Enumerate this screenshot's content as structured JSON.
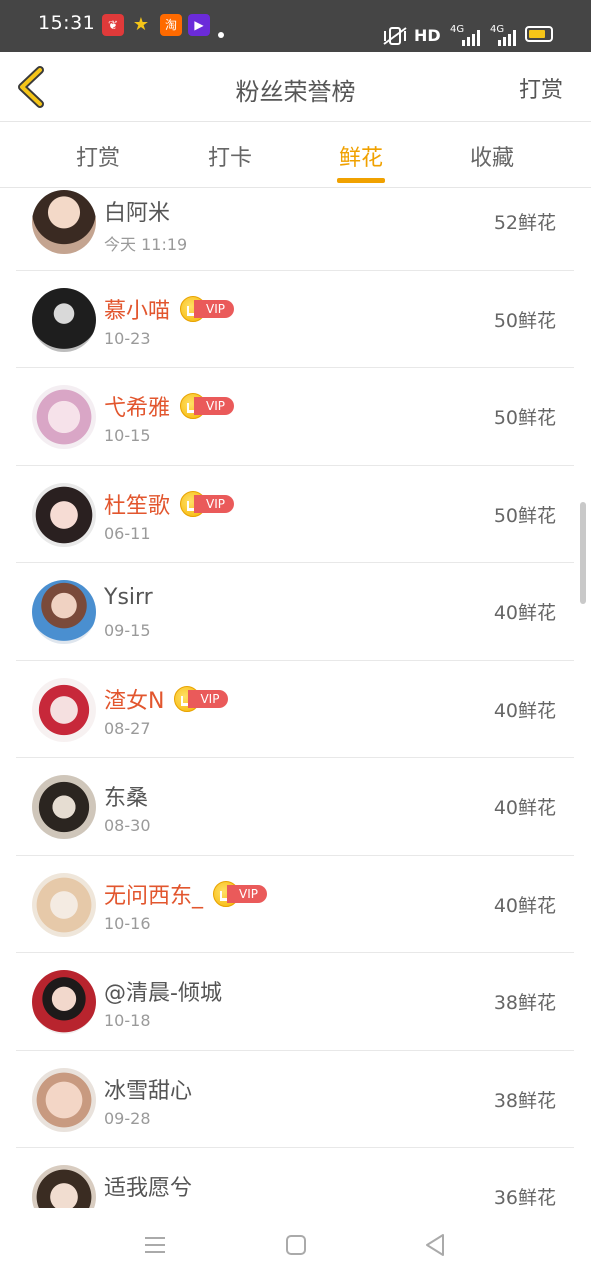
{
  "status_bar": {
    "time": "15:31",
    "network": "HD",
    "signal1": "4G",
    "signal2": "4G",
    "battery_level": 0.8
  },
  "header": {
    "title": "粉丝荣誉榜",
    "right_action": "打赏"
  },
  "tabs": [
    {
      "label": "打赏",
      "active": false
    },
    {
      "label": "打卡",
      "active": false
    },
    {
      "label": "鲜花",
      "active": true
    },
    {
      "label": "收藏",
      "active": false
    }
  ],
  "fans": [
    {
      "name": "白阿米",
      "date": "今天 11:19",
      "amount": "52鲜花",
      "vip": false
    },
    {
      "name": "慕小喵",
      "date": "10-23",
      "amount": "50鲜花",
      "vip": true,
      "vip_label": "VIP"
    },
    {
      "name": "弋希雅",
      "date": "10-15",
      "amount": "50鲜花",
      "vip": true,
      "vip_label": "VIP"
    },
    {
      "name": "杜笙歌",
      "date": "06-11",
      "amount": "50鲜花",
      "vip": true,
      "vip_label": "VIP"
    },
    {
      "name": "Ysirr",
      "date": "09-15",
      "amount": "40鲜花",
      "vip": false
    },
    {
      "name": "渣女N",
      "date": "08-27",
      "amount": "40鲜花",
      "vip": true,
      "vip_label": "VIP"
    },
    {
      "name": "东桑",
      "date": "08-30",
      "amount": "40鲜花",
      "vip": false
    },
    {
      "name": "无问西东_",
      "date": "10-16",
      "amount": "40鲜花",
      "vip": true,
      "vip_label": "VIP"
    },
    {
      "name": "@清晨-倾城",
      "date": "10-18",
      "amount": "38鲜花",
      "vip": false
    },
    {
      "name": "冰雪甜心",
      "date": "09-28",
      "amount": "38鲜花",
      "vip": false
    },
    {
      "name": "适我愿兮",
      "date": "",
      "amount": "36鲜花",
      "vip": false
    }
  ],
  "colors": {
    "accent": "#f0a100",
    "vip_name": "#e2562e",
    "vip_pill": "#ea5a5a"
  }
}
